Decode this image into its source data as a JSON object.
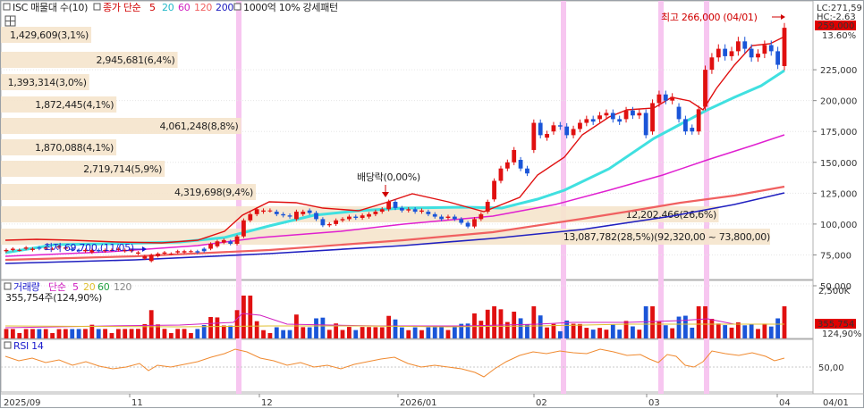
{
  "header": {
    "main_title": "ISC 매물대 수(10)",
    "ma_title": "종가 단순",
    "ma_periods": [
      "5",
      "20",
      "60",
      "120",
      "200"
    ],
    "extra_title": "1000억 10% 강세패턴"
  },
  "price_scale": {
    "ticks": [
      "225,000",
      "200,000",
      "175,000",
      "150,000",
      "125,000",
      "100,000",
      "75,000",
      "50,000"
    ],
    "ceiling_label": "LC:271,59",
    "hc_label": "HC:-2.63",
    "current_price": "259,000",
    "current_pct": "13.60%"
  },
  "volume_profile": [
    {
      "label": "1,429,609(3,1%)",
      "value": 1429609
    },
    {
      "label": "2,945,681(6,4%)",
      "value": 2945681
    },
    {
      "label": "1,393,314(3,0%)",
      "value": 1393314
    },
    {
      "label": "1,872,445(4,1%)",
      "value": 1872445
    },
    {
      "label": "4,061,248(8,8%)",
      "value": 4061248
    },
    {
      "label": "1,870,088(4,1%)",
      "value": 1870088
    },
    {
      "label": "2,719,714(5,9%)",
      "value": 2719714
    },
    {
      "label": "4,319,698(9,4%)",
      "value": 4319698
    },
    {
      "label": "12,202,466(26,6%)",
      "value": 12202466
    },
    {
      "label": "13,087,782(28,5%)(92,320,00 ~ 73,800,00)",
      "value": 13087782
    }
  ],
  "annotations": {
    "high": "최고 266,000 (04/01)",
    "low": "최저 69,700 (11/05)",
    "dividend": "배당락(0,00%)"
  },
  "volume_panel": {
    "title": "거래량",
    "ma_title": "단순",
    "ma_periods": [
      "5",
      "20",
      "60",
      "120"
    ],
    "current": "355,754주(124,90%)",
    "tick_top": "2,500K",
    "current_value": "355,754",
    "current_pct": "124,90%"
  },
  "rsi_panel": {
    "title": "RSI 14",
    "tick": "50,00"
  },
  "date_axis": [
    "2025/09",
    "11",
    "12",
    "2026/01",
    "02",
    "03",
    "04",
    "04/01"
  ],
  "chart_data": {
    "type": "candlestick",
    "ylim": [
      50000,
      275000
    ],
    "volume_ylim": [
      0,
      2500000
    ],
    "rsi_ylim": [
      0,
      100
    ],
    "candles": [
      [
        78000,
        79000
      ],
      [
        79000,
        80000
      ],
      [
        79000,
        79000
      ],
      [
        80000,
        81000
      ],
      [
        79000,
        80000
      ],
      [
        81000,
        80000
      ],
      [
        80000,
        81000
      ],
      [
        80000,
        80000
      ],
      [
        81000,
        82000
      ],
      [
        80000,
        81000
      ],
      [
        80000,
        79000
      ],
      [
        79000,
        78000
      ],
      [
        78000,
        79000
      ],
      [
        77000,
        79000
      ],
      [
        79000,
        78000
      ],
      [
        78000,
        79000
      ],
      [
        79000,
        79000
      ],
      [
        79000,
        80000
      ],
      [
        78000,
        79000
      ],
      [
        78000,
        79000
      ],
      [
        76000,
        77000
      ],
      [
        72000,
        74000
      ],
      [
        70000,
        75000
      ],
      [
        74000,
        76000
      ],
      [
        76000,
        77000
      ],
      [
        76000,
        76000
      ],
      [
        77000,
        78000
      ],
      [
        77000,
        78000
      ],
      [
        78000,
        78000
      ],
      [
        78000,
        77000
      ],
      [
        80000,
        78000
      ],
      [
        80000,
        84000
      ],
      [
        82000,
        86000
      ],
      [
        85000,
        87000
      ],
      [
        86000,
        84000
      ],
      [
        84000,
        90000
      ],
      [
        90000,
        103000
      ],
      [
        103000,
        108000
      ],
      [
        108000,
        112000
      ],
      [
        110000,
        111000
      ],
      [
        111000,
        111000
      ],
      [
        110000,
        108000
      ],
      [
        108000,
        107000
      ],
      [
        107000,
        106000
      ],
      [
        104000,
        110000
      ],
      [
        108000,
        110000
      ],
      [
        111000,
        109000
      ],
      [
        109000,
        104000
      ],
      [
        104000,
        99000
      ],
      [
        99000,
        100000
      ],
      [
        100000,
        103000
      ],
      [
        103000,
        104000
      ],
      [
        104000,
        106000
      ],
      [
        106000,
        105000
      ],
      [
        105000,
        107000
      ],
      [
        106000,
        108000
      ],
      [
        108000,
        110000
      ],
      [
        110000,
        112000
      ],
      [
        112000,
        118000
      ],
      [
        118000,
        113000
      ],
      [
        113000,
        111000
      ],
      [
        111000,
        112000
      ],
      [
        112000,
        110000
      ],
      [
        110000,
        111000
      ],
      [
        110000,
        108000
      ],
      [
        108000,
        106000
      ],
      [
        106000,
        104000
      ],
      [
        105000,
        106000
      ],
      [
        106000,
        104000
      ],
      [
        104000,
        101000
      ],
      [
        101000,
        98000
      ],
      [
        98000,
        104000
      ],
      [
        104000,
        108000
      ],
      [
        110000,
        118000
      ],
      [
        120000,
        135000
      ],
      [
        135000,
        145000
      ],
      [
        145000,
        150000
      ],
      [
        150000,
        160000
      ],
      [
        152000,
        145000
      ],
      [
        145000,
        141000
      ],
      [
        160000,
        182000
      ],
      [
        182000,
        172000
      ],
      [
        170000,
        173000
      ],
      [
        175000,
        180000
      ],
      [
        180000,
        179000
      ],
      [
        179000,
        172000
      ],
      [
        172000,
        177000
      ],
      [
        177000,
        182000
      ],
      [
        182000,
        185000
      ],
      [
        185000,
        183000
      ],
      [
        185000,
        188000
      ],
      [
        188000,
        190000
      ],
      [
        190000,
        185000
      ],
      [
        185000,
        183000
      ],
      [
        185000,
        192000
      ],
      [
        192000,
        188000
      ],
      [
        188000,
        190000
      ],
      [
        190000,
        172000
      ],
      [
        175000,
        198000
      ],
      [
        198000,
        205000
      ],
      [
        205000,
        200000
      ],
      [
        200000,
        203000
      ],
      [
        195000,
        185000
      ],
      [
        185000,
        175000
      ],
      [
        178000,
        175000
      ],
      [
        175000,
        193000
      ],
      [
        195000,
        225000
      ],
      [
        225000,
        235000
      ],
      [
        235000,
        242000
      ],
      [
        242000,
        236000
      ],
      [
        236000,
        240000
      ],
      [
        240000,
        248000
      ],
      [
        248000,
        242000
      ],
      [
        242000,
        235000
      ],
      [
        235000,
        238000
      ],
      [
        238000,
        245000
      ],
      [
        245000,
        240000
      ],
      [
        240000,
        229000
      ],
      [
        228000,
        259000
      ]
    ]
  }
}
